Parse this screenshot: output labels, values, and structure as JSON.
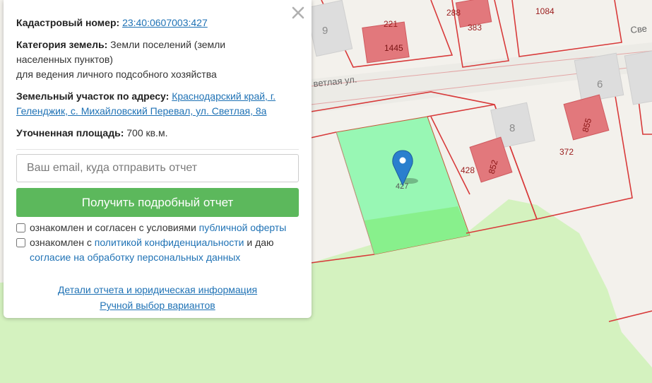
{
  "popup": {
    "cadastral_label": "Кадастровый номер:",
    "cadastral_value": "23:40:0607003:427",
    "category_label": "Категория земель:",
    "category_value_1": "Земли поселений (земли",
    "category_value_2": "населенных пунктов)",
    "category_value_3": "для ведения личного подсобного хозяйства",
    "address_label": "Земельный участок по адресу:",
    "address_value_1": "Краснодарский край, г.",
    "address_value_2": "Геленджик, с. Михайловский Перевал, ул. Светлая, 8а",
    "area_label": "Уточненная площадь:",
    "area_value": "700 кв.м.",
    "email_placeholder": "Ваш email, куда отправить отчет",
    "submit_label": "Получить подробный отчет",
    "check1_text": "ознакомлен и согласен с условиями ",
    "check1_link": "публичной оферты",
    "check2_text": "ознакомлен с ",
    "check2_link": "политикой конфиденциальности",
    "check2_text2": " и даю",
    "check2_link2": "согласие на обработку персональных данных",
    "details_link": "Детали отчета и юридическая информация",
    "manual_link": "Ручной выбор вариантов"
  },
  "map": {
    "street_label": "ветлая ул.",
    "street_label_2": "Све",
    "marker_label": "427",
    "colors": {
      "selected": "#98f7b4",
      "selected_lower": "#88f08c",
      "building": "#e2787c",
      "border": "#d83a3a",
      "greenery": "#d4f2bf",
      "house": "#dddddd"
    },
    "labels": [
      {
        "id": "n9",
        "text": "9"
      },
      {
        "id": "n221",
        "text": "221"
      },
      {
        "id": "n1445",
        "text": "1445"
      },
      {
        "id": "n288",
        "text": "288"
      },
      {
        "id": "n383",
        "text": "383"
      },
      {
        "id": "n1084",
        "text": "1084"
      },
      {
        "id": "n6",
        "text": "6"
      },
      {
        "id": "n8",
        "text": "8"
      },
      {
        "id": "n855",
        "text": "855"
      },
      {
        "id": "n372",
        "text": "372"
      },
      {
        "id": "n428",
        "text": "428"
      },
      {
        "id": "n852",
        "text": "852"
      }
    ]
  }
}
